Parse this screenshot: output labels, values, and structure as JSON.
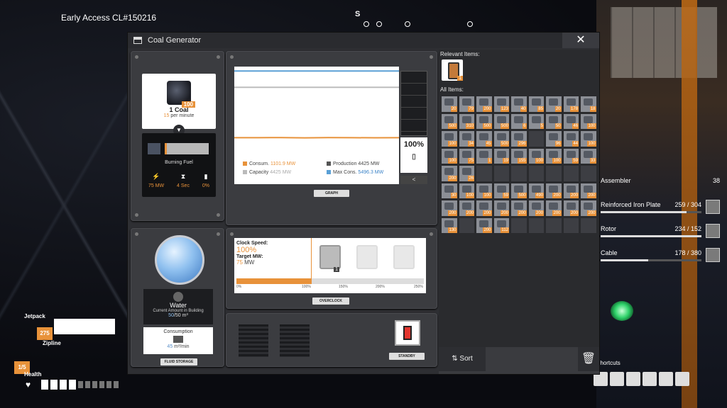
{
  "hud": {
    "build": "Early Access CL#150216",
    "compass": "S",
    "jetpack_label": "Jetpack",
    "jetpack_count": "275",
    "zipline_label": "Zipline",
    "zipline_count": "1/5",
    "health_label": "Health",
    "shortcuts_label": "Shortcuts",
    "objectives": [
      {
        "label": "Assembler",
        "count": "38",
        "progress": 1.0
      },
      {
        "label": "Reinforced Iron Plate",
        "count": "259 / 304",
        "progress": 0.85
      },
      {
        "label": "Rotor",
        "count": "234 / 152",
        "progress": 1.0
      },
      {
        "label": "Cable",
        "count": "178 / 380",
        "progress": 0.47
      }
    ]
  },
  "window": {
    "title": "Coal Generator",
    "close": "✕"
  },
  "fuel": {
    "item_name": "1 Coal",
    "rate_value": "15",
    "rate_unit": "per minute",
    "stack": "100",
    "burning_label": "Burning Fuel",
    "power": "75 MW",
    "time": "4 Sec",
    "percent": "0%"
  },
  "graph": {
    "consum_label": "Consum.",
    "consum_value": "1101.9 MW",
    "production_label": "Production",
    "production_value": "4425 MW",
    "capacity_label": "Capacity",
    "capacity_value": "4425 MW",
    "maxcons_label": "Max Cons.",
    "maxcons_value": "5496.3 MW",
    "percent": "100%",
    "back": "<",
    "tag": "GRAPH",
    "colors": {
      "consum": "#e8923a",
      "production": "#555555",
      "capacity": "#bbbbbb",
      "maxcons": "#5aa0d6"
    }
  },
  "chart_data": {
    "type": "line",
    "series": [
      {
        "name": "Consum.",
        "values": [
          1100,
          1100,
          1110,
          1090,
          1105,
          1100,
          1095,
          1102
        ]
      },
      {
        "name": "Production",
        "values": [
          4425,
          4425,
          4425,
          4425,
          4425,
          4425,
          4425,
          4425
        ]
      },
      {
        "name": "Max Cons.",
        "values": [
          5496.3,
          5496.3,
          5496.3,
          5496.3,
          5496.3,
          5496.3,
          5496.3,
          5496.3
        ]
      }
    ],
    "ylim": [
      0,
      5600
    ]
  },
  "water": {
    "name": "Water",
    "sub": "Current Amount in Building",
    "amount_current": "50",
    "amount_max": "/50 m³",
    "consumption_label": "Consumption",
    "consumption_value": "45",
    "consumption_unit": "m³/min",
    "tag": "FLUID STORAGE"
  },
  "overclock": {
    "clock_label": "Clock Speed:",
    "clock_value": "100%",
    "target_label": "Target MW:",
    "target_value": "75",
    "target_unit": "MW",
    "shard_count": "1",
    "fill": 0.4,
    "ticks": [
      "0%",
      "100%",
      "150%",
      "200%",
      "250%"
    ],
    "tag": "OVERCLOCK"
  },
  "standby": {
    "tag": "STANDBY"
  },
  "inventory": {
    "relevant_label": "Relevant Items:",
    "relevant_count": "1",
    "all_label": "All Items:",
    "sort": "Sort",
    "trash_icon": "trash-icon",
    "slots": [
      "20",
      "79",
      "200",
      "123",
      "40",
      "85",
      "20",
      "178",
      "18",
      "500",
      "310",
      "500",
      "500",
      "6",
      "5",
      "50",
      "46",
      "100",
      "100",
      "34",
      "45",
      "500",
      "296",
      "",
      "96",
      "44",
      "100",
      "100",
      "75",
      "1",
      "19",
      "155",
      "100",
      "100",
      "59",
      "33",
      "200",
      "26",
      "",
      "",
      "",
      "",
      "",
      "",
      "",
      "30",
      "100",
      "100",
      "59",
      "500",
      "490",
      "200",
      "200",
      "200",
      "200",
      "200",
      "200",
      "200",
      "200",
      "200",
      "200",
      "200",
      "200",
      "130",
      "",
      "200",
      "112",
      "",
      "",
      "",
      "",
      ""
    ]
  }
}
